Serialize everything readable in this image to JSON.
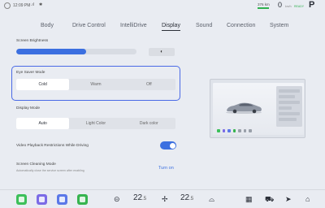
{
  "status": {
    "time": "12:09 PM",
    "signal": ".ıl",
    "bluetooth": "✱",
    "range": "376 km",
    "speed": "0",
    "speed_unit": "km/h",
    "ready": "READY",
    "gear": "P"
  },
  "tabs": [
    {
      "label": "Body",
      "active": false
    },
    {
      "label": "Drive Control",
      "active": false
    },
    {
      "label": "IntelliDrive",
      "active": false
    },
    {
      "label": "Display",
      "active": true
    },
    {
      "label": "Sound",
      "active": false
    },
    {
      "label": "Connection",
      "active": false
    },
    {
      "label": "System",
      "active": false
    }
  ],
  "brightness": {
    "label": "Screen Brightness",
    "level_percent": 58,
    "auto_icon": "◐",
    "accent": "#3b6fe0"
  },
  "eye_saver": {
    "label": "Eye Saver Mode",
    "options": [
      "Cold",
      "Warm",
      "Off"
    ],
    "selected": "Cold",
    "highlight": "#4a6ae6"
  },
  "display_mode": {
    "label": "Display Mode",
    "options": [
      "Auto",
      "Light Color",
      "Dark color"
    ],
    "selected": "Auto"
  },
  "video_restriction": {
    "label": "Video Playback Restrictions While Driving",
    "enabled": true
  },
  "cleaning": {
    "label": "Screen Cleaning Mode",
    "description": "Automatically close the service screen after enabling",
    "action": "Turn on"
  },
  "dock": {
    "apps": [
      {
        "name": "app-green",
        "color": "#3cc05a"
      },
      {
        "name": "app-purple",
        "color": "#7b6be6"
      },
      {
        "name": "app-blue",
        "color": "#5b78e8"
      },
      {
        "name": "app-phone",
        "color": "#36b44f"
      }
    ],
    "left_temp": "22",
    "left_temp_dec": ".5",
    "right_temp": "22",
    "right_temp_dec": ".5",
    "icons": {
      "steering": "⊝",
      "fan": "✢",
      "seat": "⌓",
      "grid": "▦",
      "car": "⛟",
      "nav": "➤",
      "home": "⌂"
    }
  }
}
